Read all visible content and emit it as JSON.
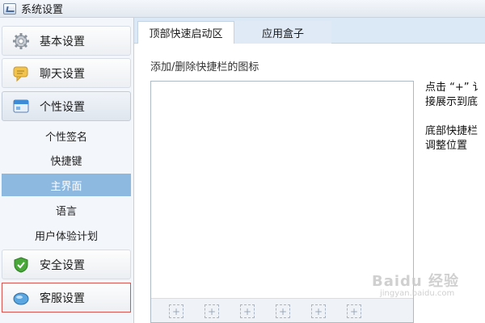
{
  "window": {
    "title": "系统设置"
  },
  "sidebar": {
    "groups": [
      {
        "label": "基本设置",
        "icon": "gear-icon"
      },
      {
        "label": "聊天设置",
        "icon": "chat-bubble-icon"
      },
      {
        "label": "个性设置",
        "icon": "personalize-icon"
      },
      {
        "label": "安全设置",
        "icon": "shield-icon"
      },
      {
        "label": "客服设置",
        "icon": "customer-service-icon"
      }
    ],
    "sub_items": [
      "个性签名",
      "快捷键",
      "主界面",
      "语言",
      "用户体验计划"
    ],
    "selected_sub_item": "主界面"
  },
  "tabs": [
    {
      "label": "顶部快速启动区",
      "active": true
    },
    {
      "label": "应用盒子",
      "active": false
    }
  ],
  "content": {
    "section_label": "添加/删除快捷栏的图标",
    "add_button_symbol": "+",
    "help_lines": [
      "点击 “+” 讠",
      "接展示到底",
      "底部快捷栏",
      "调整位置"
    ]
  },
  "watermark": {
    "text": "Baidu 经验",
    "sub": "jingyan.baidu.com"
  },
  "colors": {
    "selected": "#8db8e0",
    "tab_bar": "#dbe8f6",
    "highlight_border": "#d9534f"
  }
}
